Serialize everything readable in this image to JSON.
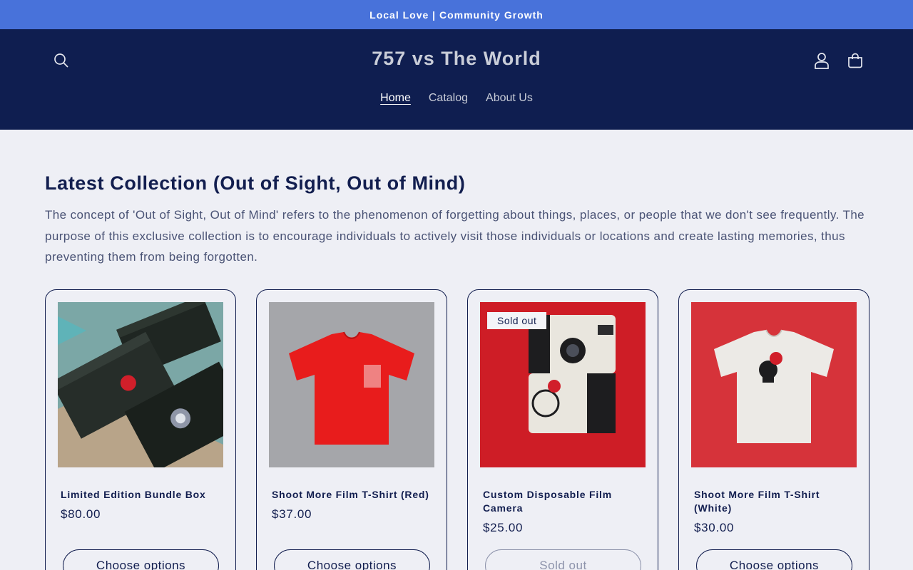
{
  "announcement": {
    "text": "Local Love | Community Growth"
  },
  "header": {
    "logo": "757 vs The World",
    "nav": [
      {
        "label": "Home",
        "active": true
      },
      {
        "label": "Catalog",
        "active": false
      },
      {
        "label": "About Us",
        "active": false
      }
    ]
  },
  "collection": {
    "title": "Latest Collection (Out of Sight, Out of Mind)",
    "description": "The concept of 'Out of Sight, Out of Mind' refers to the phenomenon of forgetting about things, places, or people that we don't see frequently. The purpose of this exclusive collection is to encourage individuals to actively visit those individuals or locations and create lasting memories, thus preventing them from being forgotten."
  },
  "products": [
    {
      "title": "Limited Edition Bundle Box",
      "price": "$80.00",
      "button": "Choose options"
    },
    {
      "title": "Shoot More Film T-Shirt (Red)",
      "price": "$37.00",
      "button": "Choose options"
    },
    {
      "title": "Custom Disposable Film Camera",
      "price": "$25.00",
      "badge": "Sold out",
      "button": "Sold out"
    },
    {
      "title": "Shoot More Film T-Shirt (White)",
      "price": "$30.00",
      "button": "Choose options"
    }
  ],
  "colors": {
    "announcement_bg": "#4872da",
    "header_bg": "#0f1e50",
    "page_bg": "#eeeff5",
    "text": "#121e4f"
  },
  "icons": [
    "search-icon",
    "account-icon",
    "cart-icon"
  ]
}
